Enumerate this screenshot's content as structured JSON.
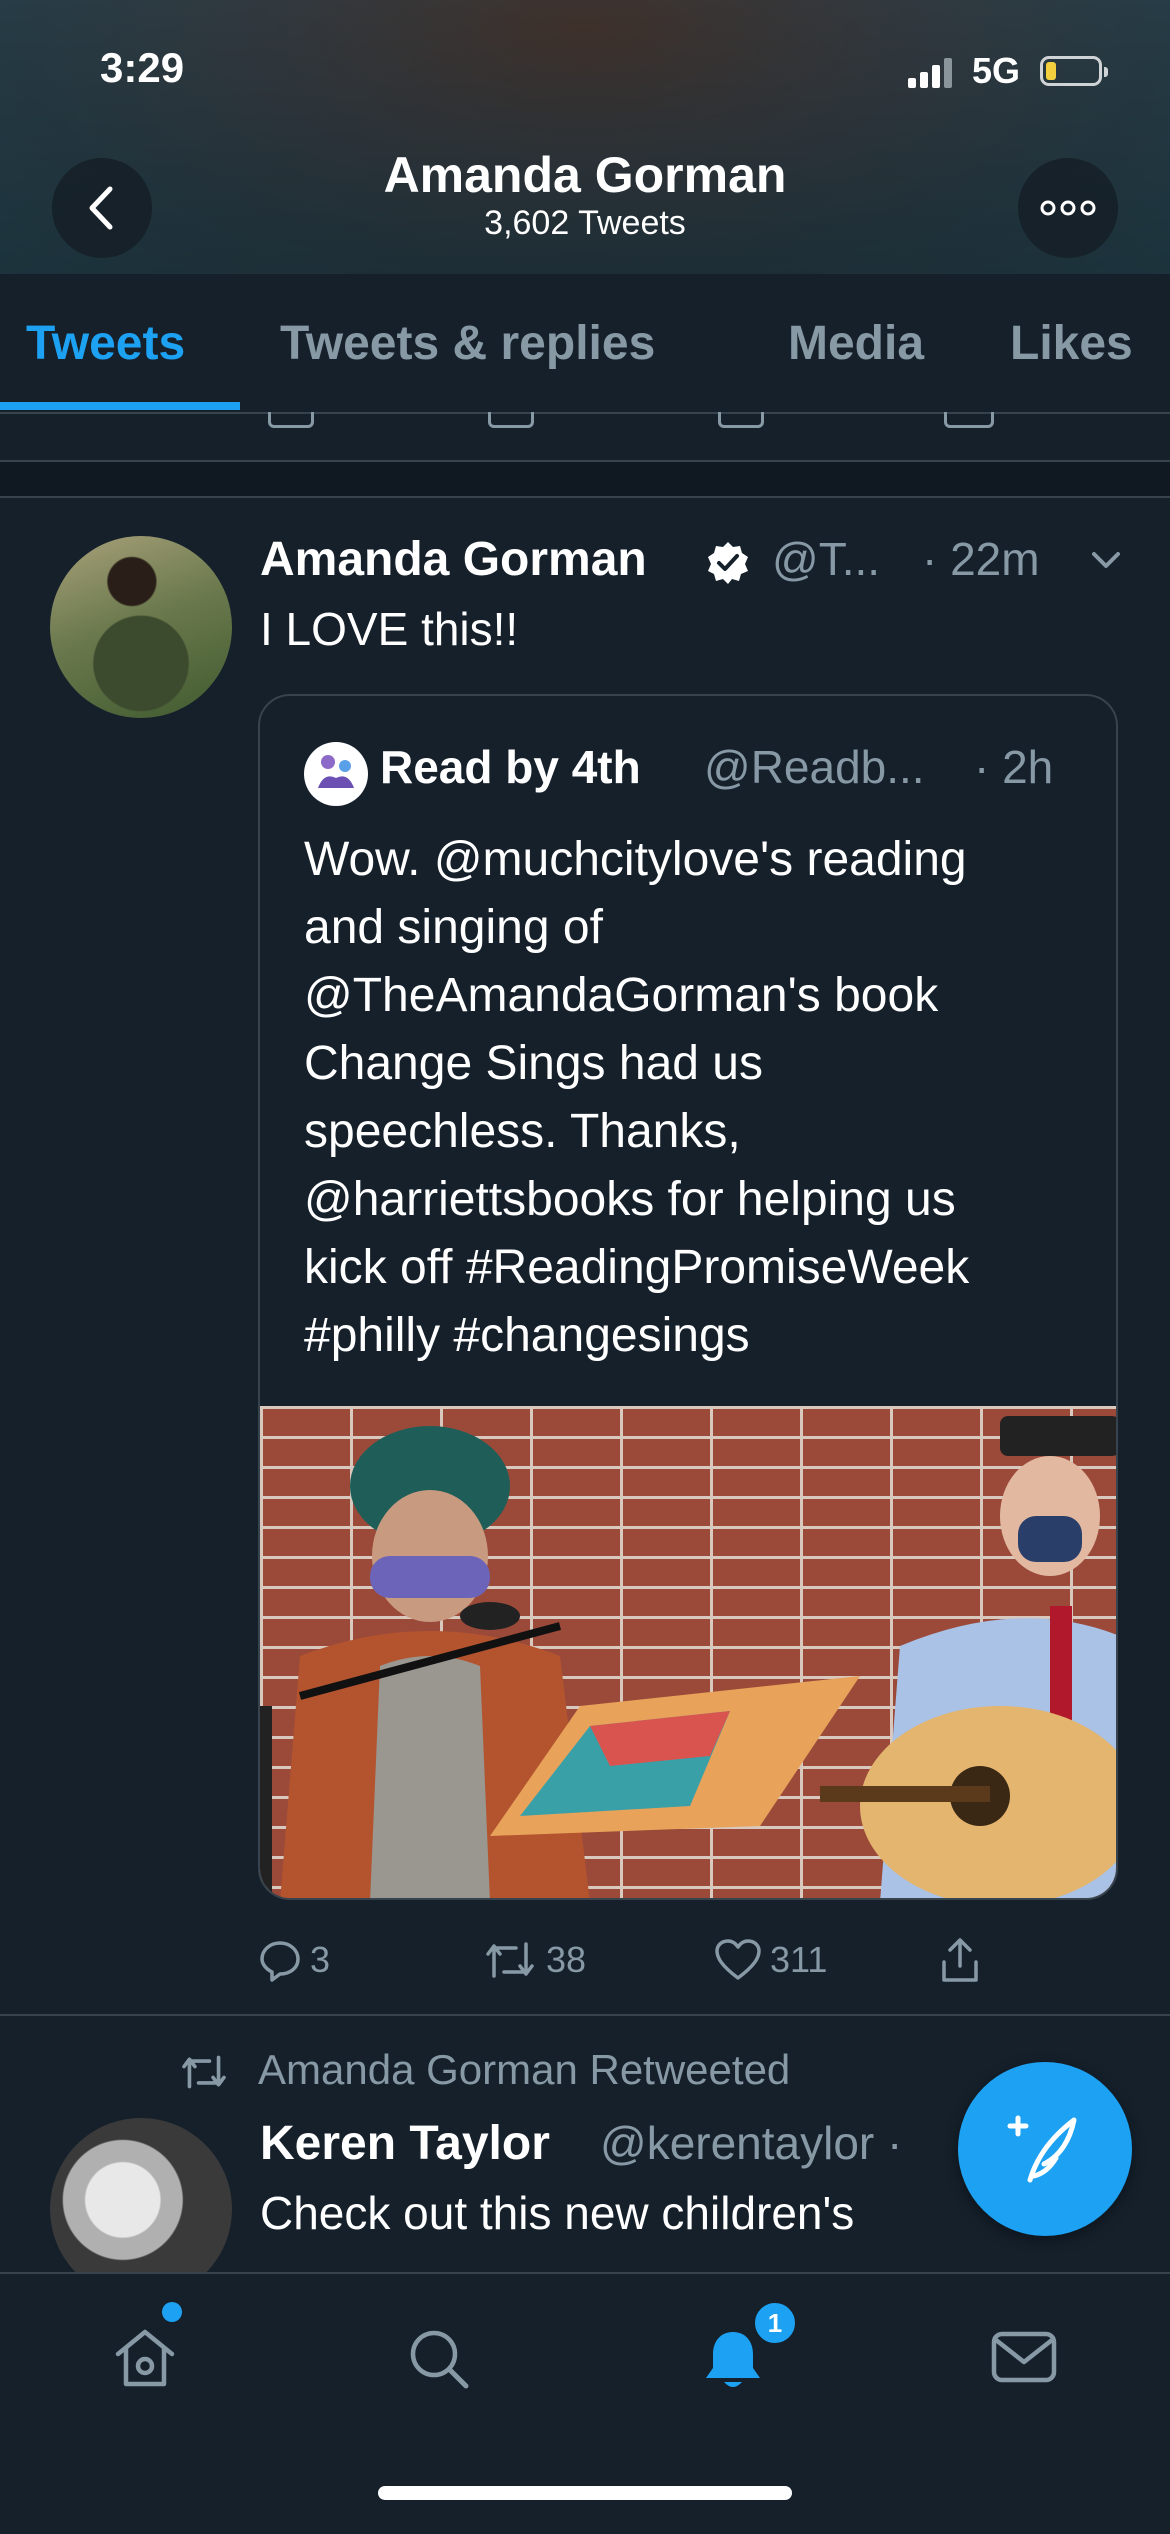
{
  "status_bar": {
    "time": "3:29",
    "network": "5G"
  },
  "header": {
    "name": "Amanda Gorman",
    "tweet_count": "3,602 Tweets"
  },
  "tabs": [
    {
      "label": "Tweets",
      "active": true
    },
    {
      "label": "Tweets & replies",
      "active": false
    },
    {
      "label": "Media",
      "active": false
    },
    {
      "label": "Likes",
      "active": false
    }
  ],
  "tweet": {
    "author_name": "Amanda Gorman",
    "handle": "@T...",
    "time": "· 22m",
    "text": "I LOVE this!!",
    "quoted": {
      "author_name": "Read by 4th",
      "handle": "@Readb...",
      "time": "· 2h",
      "text_lines": [
        "Wow. @muchcitylove's reading",
        "and singing of",
        "@TheAmandaGorman's book",
        "Change Sings had us",
        "speechless. Thanks,",
        "@harriettsbooks for helping us",
        "kick off #ReadingPromiseWeek",
        "#philly #changesings"
      ]
    },
    "actions": {
      "replies": "3",
      "retweets": "38",
      "likes": "311"
    }
  },
  "retweet": {
    "label": "Amanda Gorman Retweeted",
    "author_name": "Keren Taylor",
    "handle": "@kerentaylor ·",
    "text": "Check out this new children's"
  },
  "bottom_nav": {
    "notifications_badge": "1"
  },
  "colors": {
    "background": "#15202b",
    "accent": "#1da1f2",
    "secondary_text": "#8899a6",
    "border": "#38444d"
  },
  "icons": [
    "back-icon",
    "more-icon",
    "verified-icon",
    "chevron-down-icon",
    "reply-icon",
    "retweet-icon",
    "like-icon",
    "share-icon",
    "compose-icon",
    "home-icon",
    "search-icon",
    "notifications-icon",
    "messages-icon"
  ]
}
